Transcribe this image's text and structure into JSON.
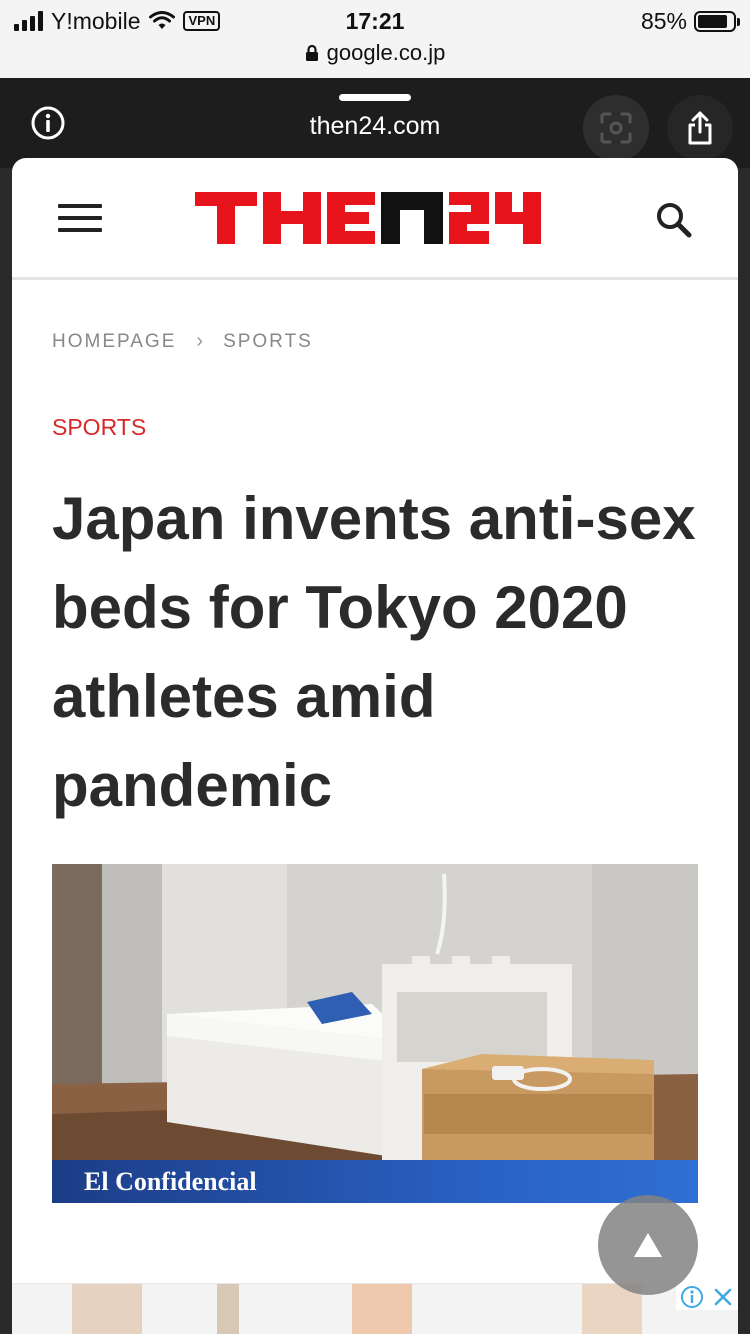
{
  "status_bar": {
    "carrier": "Y!mobile",
    "vpn": "VPN",
    "time": "17:21",
    "battery_percent": "85%",
    "battery_level": 0.85,
    "address": "google.co.jp"
  },
  "browser": {
    "domain": "then24.com",
    "icons": [
      "info-icon",
      "lens-icon",
      "share-icon",
      "lock-icon"
    ]
  },
  "site": {
    "logo_text": "THEN24",
    "brand_color": "#e8141b",
    "menu_icon": "hamburger-icon",
    "search_icon": "search-icon"
  },
  "breadcrumb": {
    "home": "HOMEPAGE",
    "separator": "›",
    "section": "SPORTS"
  },
  "article": {
    "category": "SPORTS",
    "category_color": "#d62a2a",
    "headline": "Japan invents anti-sex beds for Tokyo 2020 athletes amid pandemic",
    "image_caption": "El Confidencial"
  },
  "controls": {
    "scroll_top_icon": "triangle-up-icon",
    "ad_info_icon": "ad-info-icon",
    "ad_close_icon": "close-icon"
  }
}
